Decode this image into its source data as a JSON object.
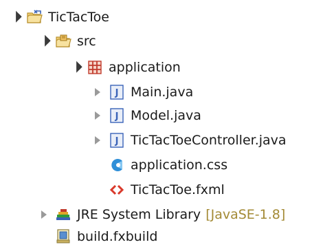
{
  "tree": {
    "project": {
      "label": "TicTacToe",
      "icon": "project-folder-icon"
    },
    "src": {
      "label": "src",
      "icon": "source-folder-icon"
    },
    "package": {
      "label": "application",
      "icon": "package-icon"
    },
    "files": [
      {
        "label": "Main.java",
        "icon": "java-file-icon"
      },
      {
        "label": "Model.java",
        "icon": "java-file-icon"
      },
      {
        "label": "TicTacToeController.java",
        "icon": "java-file-icon"
      },
      {
        "label": "application.css",
        "icon": "css-file-icon"
      },
      {
        "label": "TicTacToe.fxml",
        "icon": "fxml-file-icon"
      }
    ],
    "jre": {
      "label": "JRE System Library",
      "decoration": "[JavaSE-1.8]",
      "icon": "library-icon"
    },
    "build": {
      "label": "build.fxbuild",
      "icon": "build-file-icon"
    }
  },
  "colors": {
    "decoration": "#a38a35",
    "java_icon": "#3a63b8",
    "package_icon": "#c0392b",
    "folder_icon": "#e8b84a"
  }
}
